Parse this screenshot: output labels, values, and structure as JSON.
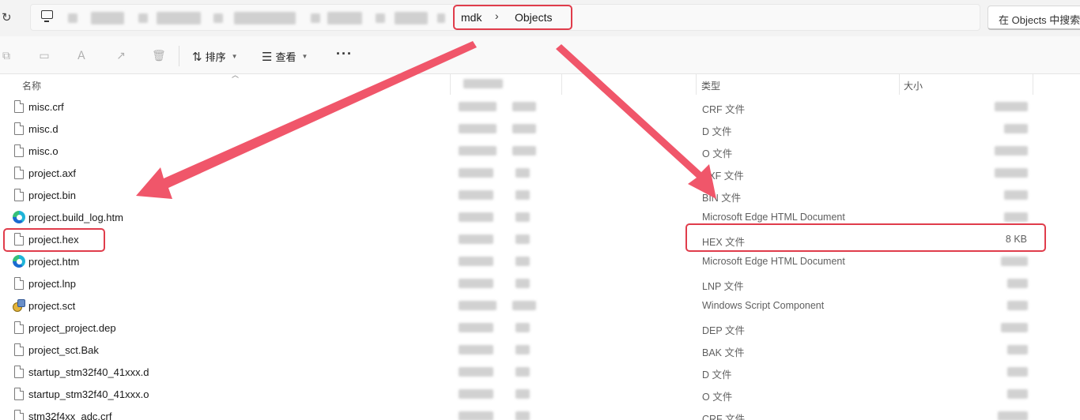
{
  "address": {
    "crumbs": [
      "mdk",
      "Objects"
    ],
    "separator": "›",
    "search_placeholder": "在 Objects 中搜索"
  },
  "toolbar": {
    "sort_label": "排序",
    "view_label": "查看",
    "more_label": "···"
  },
  "columns": {
    "name": "名称",
    "type": "类型",
    "size": "大小"
  },
  "files": [
    {
      "name": "misc.crf",
      "type": "CRF 文件",
      "icon": "file-icon"
    },
    {
      "name": "misc.d",
      "type": "D 文件",
      "icon": "file-icon"
    },
    {
      "name": "misc.o",
      "type": "O 文件",
      "icon": "file-icon"
    },
    {
      "name": "project.axf",
      "type": "AXF 文件",
      "icon": "file-icon"
    },
    {
      "name": "project.bin",
      "type": "BIN 文件",
      "icon": "file-icon"
    },
    {
      "name": "project.build_log.htm",
      "type": "Microsoft Edge HTML Document",
      "icon": "edge-icon"
    },
    {
      "name": "project.hex",
      "type": "HEX 文件",
      "size": "8 KB",
      "icon": "file-icon"
    },
    {
      "name": "project.htm",
      "type": "Microsoft Edge HTML Document",
      "icon": "edge-icon"
    },
    {
      "name": "project.lnp",
      "type": "LNP 文件",
      "icon": "file-icon"
    },
    {
      "name": "project.sct",
      "type": "Windows Script Component",
      "icon": "script-icon"
    },
    {
      "name": "project_project.dep",
      "type": "DEP 文件",
      "icon": "file-icon"
    },
    {
      "name": "project_sct.Bak",
      "type": "BAK 文件",
      "icon": "file-icon"
    },
    {
      "name": "startup_stm32f40_41xxx.d",
      "type": "D 文件",
      "icon": "file-icon"
    },
    {
      "name": "startup_stm32f40_41xxx.o",
      "type": "O 文件",
      "icon": "file-icon"
    },
    {
      "name": "stm32f4xx_adc.crf",
      "type": "CRF 文件",
      "icon": "file-icon"
    }
  ],
  "colors": {
    "highlight": "#e03c4b",
    "arrow": "#f0566a"
  }
}
